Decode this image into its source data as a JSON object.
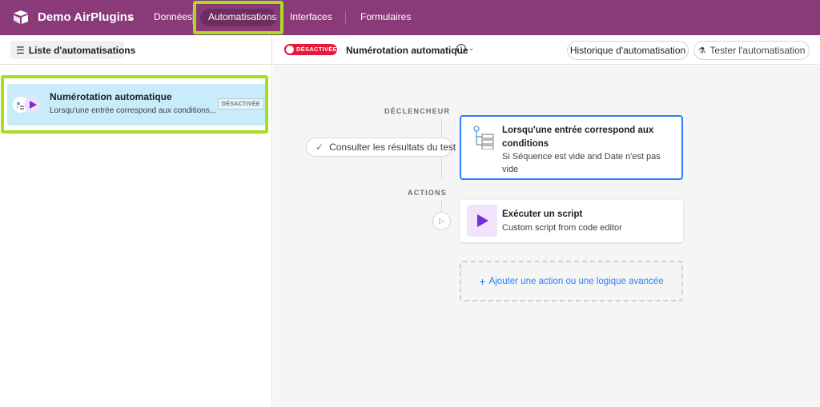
{
  "topbar": {
    "app_title": "Demo AirPlugins",
    "nav": [
      "Données",
      "Automatisations",
      "Interfaces",
      "Formulaires"
    ],
    "active_nav": "Automatisations",
    "background_color": "#8a3a78",
    "highlight_color": "#a5e01f"
  },
  "left_panel": {
    "list_button_label": "Liste d'automatisations",
    "automations": [
      {
        "title": "Numérotation automatique",
        "description": "Lorsqu'une entrée correspond aux conditions...",
        "status_badge": "DÉSACTIVÉE"
      }
    ]
  },
  "header": {
    "status_badge": "DÉSACTIVÉE",
    "automation_name": "Numérotation automatique",
    "history_button": "Historique d'automatisation",
    "test_button": "Tester l'automatisation"
  },
  "canvas": {
    "trigger_label": "DÉCLENCHEUR",
    "actions_label": "ACTIONS",
    "test_results_button": "Consulter les résultats du test",
    "trigger": {
      "title": "Lorsqu'une entrée correspond aux conditions",
      "description": "Si Séquence est vide and Date n'est pas vide"
    },
    "action": {
      "title": "Exécuter un script",
      "description": "Custom script from code editor"
    },
    "add_action_label": "Ajouter une action ou une logique avancée"
  },
  "icons": {
    "logo": "airtable-logo-icon",
    "trigger": "conditions-tree-icon",
    "action": "play-script-icon",
    "check": "check-icon",
    "info": "info-icon",
    "flask": "flask-icon"
  }
}
